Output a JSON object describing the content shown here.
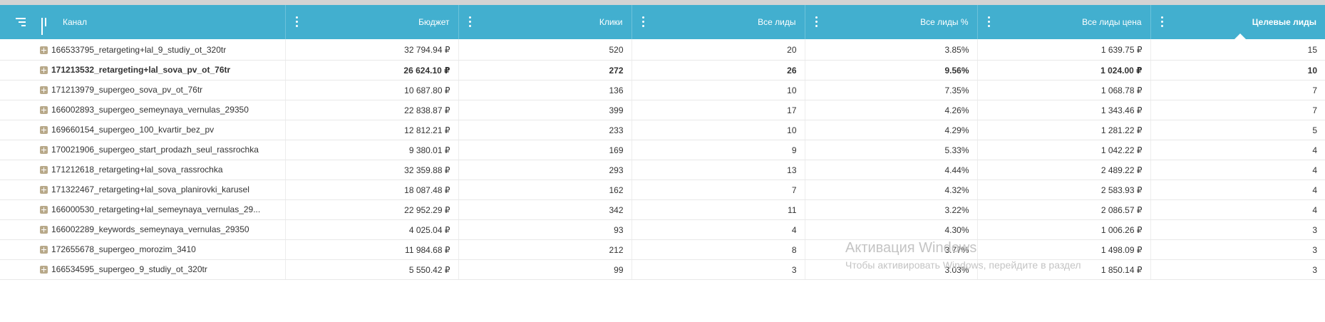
{
  "header": {
    "columns": [
      "Канал",
      "Бюджет",
      "Клики",
      "Все лиды",
      "Все лиды %",
      "Все лиды цена",
      "Целевые лиды"
    ]
  },
  "rows": [
    {
      "channel": "166533795_retargeting+lal_9_studiy_ot_320tr",
      "budget": "32 794.94 ₽",
      "clicks": "520",
      "leads": "20",
      "leads_pct": "3.85%",
      "lead_price": "1 639.75 ₽",
      "target_leads": "15"
    },
    {
      "channel": "171213532_retargeting+lal_sova_pv_ot_76tr",
      "budget": "26 624.10 ₽",
      "clicks": "272",
      "leads": "26",
      "leads_pct": "9.56%",
      "lead_price": "1 024.00 ₽",
      "target_leads": "10"
    },
    {
      "channel": "171213979_supergeo_sova_pv_ot_76tr",
      "budget": "10 687.80 ₽",
      "clicks": "136",
      "leads": "10",
      "leads_pct": "7.35%",
      "lead_price": "1 068.78 ₽",
      "target_leads": "7"
    },
    {
      "channel": "166002893_supergeo_semeynaya_vernulas_29350",
      "budget": "22 838.87 ₽",
      "clicks": "399",
      "leads": "17",
      "leads_pct": "4.26%",
      "lead_price": "1 343.46 ₽",
      "target_leads": "7"
    },
    {
      "channel": "169660154_supergeo_100_kvartir_bez_pv",
      "budget": "12 812.21 ₽",
      "clicks": "233",
      "leads": "10",
      "leads_pct": "4.29%",
      "lead_price": "1 281.22 ₽",
      "target_leads": "5"
    },
    {
      "channel": "170021906_supergeo_start_prodazh_seul_rassrochka",
      "budget": "9 380.01 ₽",
      "clicks": "169",
      "leads": "9",
      "leads_pct": "5.33%",
      "lead_price": "1 042.22 ₽",
      "target_leads": "4"
    },
    {
      "channel": "171212618_retargeting+lal_sova_rassrochka",
      "budget": "32 359.88 ₽",
      "clicks": "293",
      "leads": "13",
      "leads_pct": "4.44%",
      "lead_price": "2 489.22 ₽",
      "target_leads": "4"
    },
    {
      "channel": "171322467_retargeting+lal_sova_planirovki_karusel",
      "budget": "18 087.48 ₽",
      "clicks": "162",
      "leads": "7",
      "leads_pct": "4.32%",
      "lead_price": "2 583.93 ₽",
      "target_leads": "4"
    },
    {
      "channel": "166000530_retargeting+lal_semeynaya_vernulas_29...",
      "budget": "22 952.29 ₽",
      "clicks": "342",
      "leads": "11",
      "leads_pct": "3.22%",
      "lead_price": "2 086.57 ₽",
      "target_leads": "4"
    },
    {
      "channel": "166002289_keywords_semeynaya_vernulas_29350",
      "budget": "4 025.04 ₽",
      "clicks": "93",
      "leads": "4",
      "leads_pct": "4.30%",
      "lead_price": "1 006.26 ₽",
      "target_leads": "3"
    },
    {
      "channel": "172655678_supergeo_morozim_3410",
      "budget": "11 984.68 ₽",
      "clicks": "212",
      "leads": "8",
      "leads_pct": "3.77%",
      "lead_price": "1 498.09 ₽",
      "target_leads": "3"
    },
    {
      "channel": "166534595_supergeo_9_studiy_ot_320tr",
      "budget": "5 550.42 ₽",
      "clicks": "99",
      "leads": "3",
      "leads_pct": "3.03%",
      "lead_price": "1 850.14 ₽",
      "target_leads": "3"
    }
  ],
  "bold_row_index": 1,
  "watermark": {
    "title": "Активация Windows",
    "subtitle": "Чтобы активировать Windows, перейдите в раздел"
  },
  "colors": {
    "header_bg": "#42afcf",
    "header_text": "#ffffff",
    "expand_icon": "#b8a98a"
  }
}
